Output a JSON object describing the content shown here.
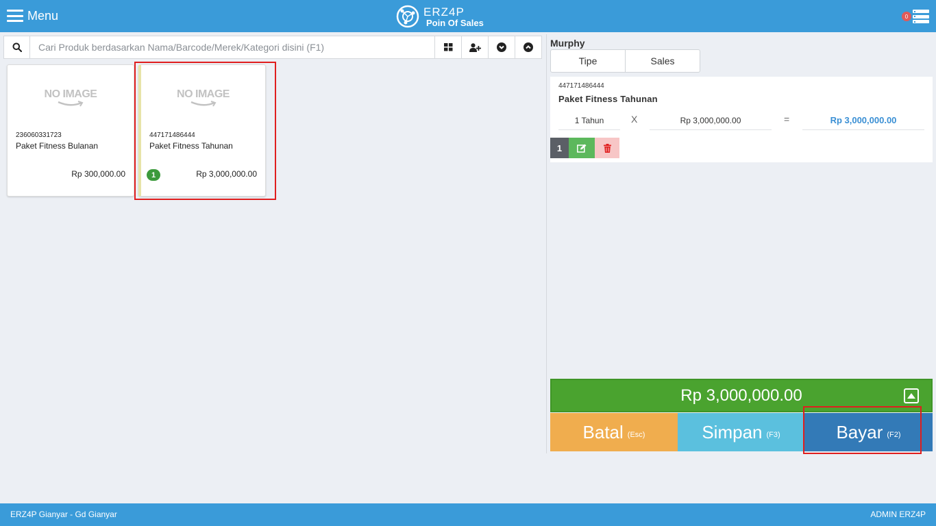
{
  "header": {
    "menu_label": "Menu",
    "brand": "ERZ4P",
    "subtitle": "Poin Of Sales",
    "notification_count": "0"
  },
  "search": {
    "placeholder": "Cari Produk berdasarkan Nama/Barcode/Merek/Kategori disini (F1)",
    "value": ""
  },
  "toolbar": {
    "icons": [
      "grid-icon",
      "add-user-icon",
      "chevron-down-circle-icon",
      "chevron-up-circle-icon"
    ]
  },
  "products": [
    {
      "image_text": "NO IMAGE",
      "code": "236060331723",
      "name": "Paket Fitness Bulanan",
      "price": "Rp 300,000.00",
      "qty": ""
    },
    {
      "image_text": "NO IMAGE",
      "code": "447171486444",
      "name": "Paket Fitness Tahunan",
      "price": "Rp 3,000,000.00",
      "qty": "1"
    }
  ],
  "cart": {
    "customer": "Murphy",
    "tabs": [
      "Tipe",
      "Sales"
    ],
    "items": [
      {
        "code": "447171486444",
        "name": "Paket Fitness Tahunan",
        "qty": "1 Tahun",
        "times": "X",
        "price": "Rp 3,000,000.00",
        "equals": "=",
        "total": "Rp 3,000,000.00",
        "line_no": "1"
      }
    ],
    "grand_total": "Rp 3,000,000.00"
  },
  "actions": {
    "batal": {
      "label": "Batal",
      "key": "(Esc)"
    },
    "simpan": {
      "label": "Simpan",
      "key": "(F3)"
    },
    "bayar": {
      "label": "Bayar",
      "key": "(F2)"
    }
  },
  "footer": {
    "location": "ERZ4P Gianyar - Gd Gianyar",
    "user": "ADMIN ERZ4P"
  },
  "colors": {
    "primary": "#3a9bd9",
    "total_green": "#4aa32f",
    "batal": "#f0ad4e",
    "simpan": "#5bc0de",
    "bayar": "#337ab7",
    "highlight": "#e01e1e"
  }
}
